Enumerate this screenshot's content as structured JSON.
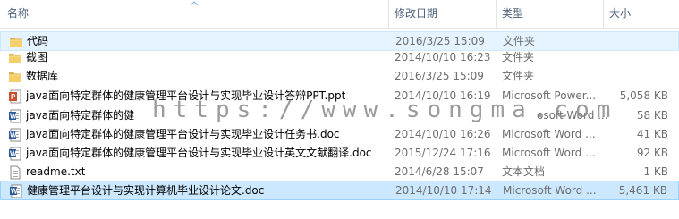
{
  "header": {
    "name": "名称",
    "date": "修改日期",
    "type": "类型",
    "size": "大小"
  },
  "files": [
    {
      "name": "代码",
      "date": "2016/3/25 15:09",
      "type": "文件夹",
      "size": "",
      "icon": "folder-icon",
      "state": "selected"
    },
    {
      "name": "截图",
      "date": "2014/10/10 16:23",
      "type": "文件夹",
      "size": "",
      "icon": "folder-icon",
      "state": ""
    },
    {
      "name": "数据库",
      "date": "2016/3/25 15:09",
      "type": "文件夹",
      "size": "",
      "icon": "folder-icon",
      "state": ""
    },
    {
      "name": "java面向特定群体的健康管理平台设计与实现毕业设计答辩PPT.ppt",
      "date": "2014/10/10 16:19",
      "type": "Microsoft Power...",
      "size": "5,058 KB",
      "icon": "powerpoint-icon",
      "state": ""
    },
    {
      "name": "java面向特定群体的健",
      "date": "",
      "type": "osoft Word ...",
      "size": "58 KB",
      "icon": "word-doc-icon",
      "state": ""
    },
    {
      "name": "java面向特定群体的健康管理平台设计与实现毕业设计任务书.doc",
      "date": "2014/10/10 16:26",
      "type": "Microsoft Word ...",
      "size": "41 KB",
      "icon": "word-doc-icon",
      "state": ""
    },
    {
      "name": "java面向特定群体的健康管理平台设计与实现毕业设计英文文献翻译.doc",
      "date": "2015/12/24 17:16",
      "type": "Microsoft Word ...",
      "size": "92 KB",
      "icon": "word-doc-icon",
      "state": ""
    },
    {
      "name": "readme.txt",
      "date": "2014/6/28 15:07",
      "type": "文本文档",
      "size": "1 KB",
      "icon": "text-file-icon",
      "state": ""
    },
    {
      "name": "健康管理平台设计与实现计算机毕业设计论文.doc",
      "date": "2014/10/10 17:14",
      "type": "Microsoft Word ...",
      "size": "5,461 KB",
      "icon": "word-doc-icon",
      "state": "selected-strong"
    }
  ],
  "watermark": "https://www.songma.com"
}
